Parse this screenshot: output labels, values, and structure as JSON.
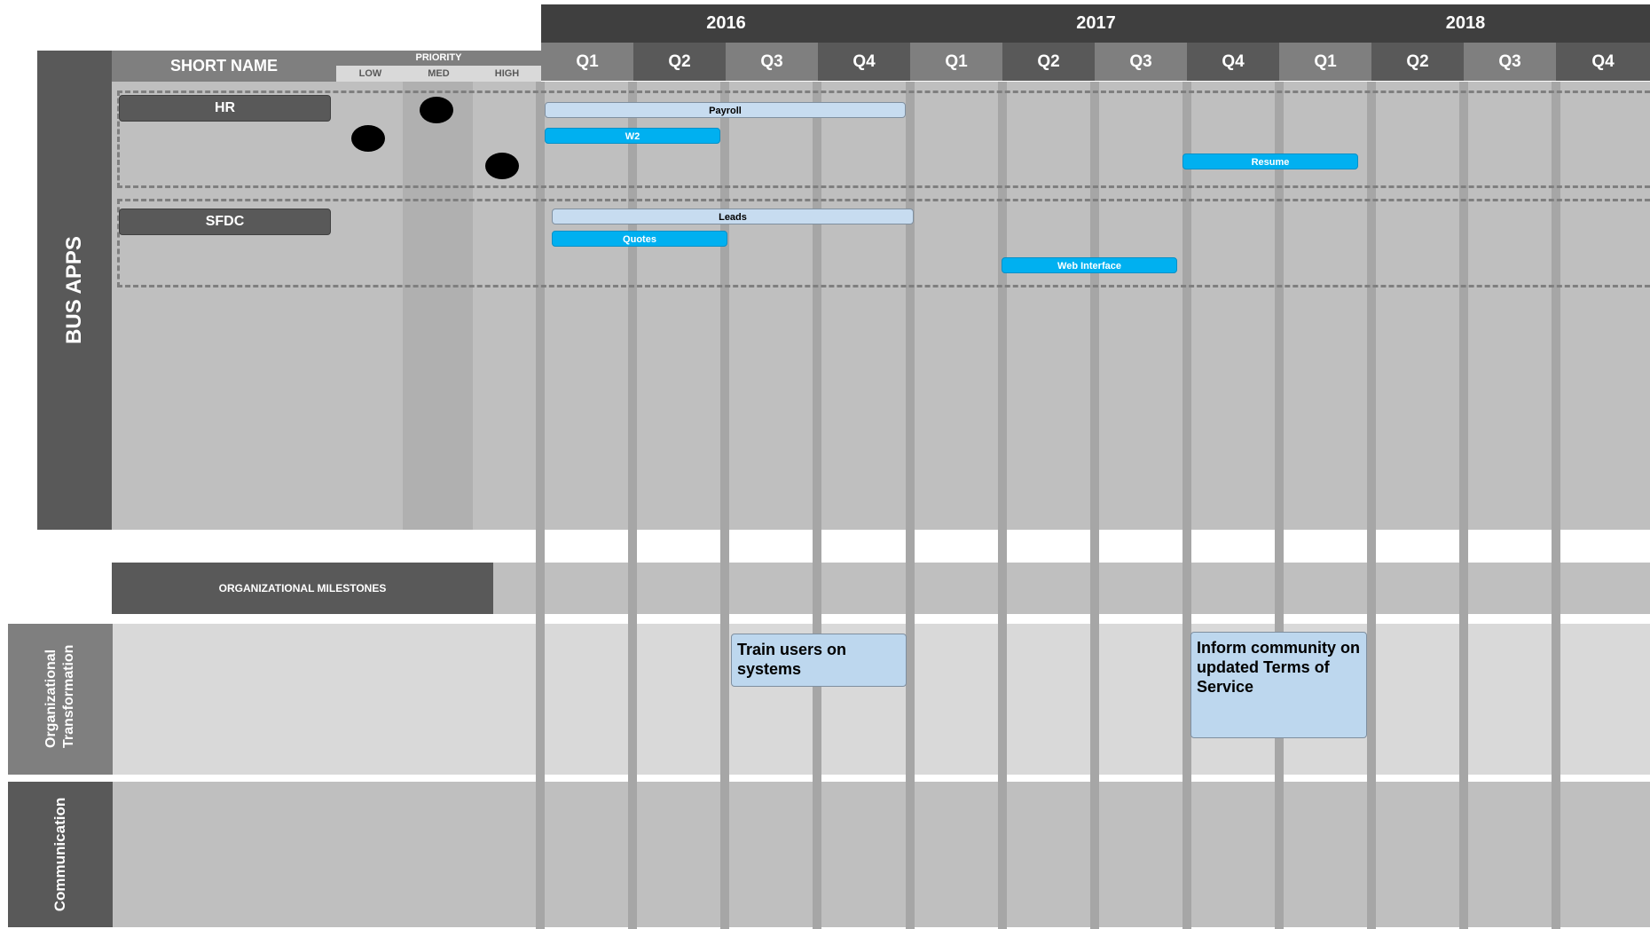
{
  "years": [
    "2016",
    "2017",
    "2018"
  ],
  "quarters": [
    "Q1",
    "Q2",
    "Q3",
    "Q4",
    "Q1",
    "Q2",
    "Q3",
    "Q4",
    "Q1",
    "Q2",
    "Q3",
    "Q4"
  ],
  "header": {
    "short_name": "SHORT NAME",
    "priority": "PRIORITY",
    "priority_levels": [
      "LOW",
      "MED",
      "HIGH"
    ]
  },
  "section_label": "BUS APPS",
  "groups": [
    {
      "name": "HR",
      "bars": [
        {
          "label": "Payroll",
          "style": "light"
        },
        {
          "label": "W2",
          "style": "blue"
        },
        {
          "label": "Resume",
          "style": "blue"
        }
      ]
    },
    {
      "name": "SFDC",
      "bars": [
        {
          "label": "Leads",
          "style": "light"
        },
        {
          "label": "Quotes",
          "style": "blue"
        },
        {
          "label": "Web Interface",
          "style": "blue"
        }
      ]
    }
  ],
  "milestones_label": "ORGANIZATIONAL MILESTONES",
  "rows": {
    "org_transformation": "Organizational Transformation",
    "communication": "Communication"
  },
  "notes": [
    "Train users on systems",
    "Inform community on updated Terms of Service"
  ],
  "colors": {
    "dark_gray": "#595959",
    "header_gray": "#7f7f7f",
    "grid_gray": "#bfbfbf",
    "light_bar": "#c7dcf0",
    "blue_bar": "#00b0f0"
  }
}
